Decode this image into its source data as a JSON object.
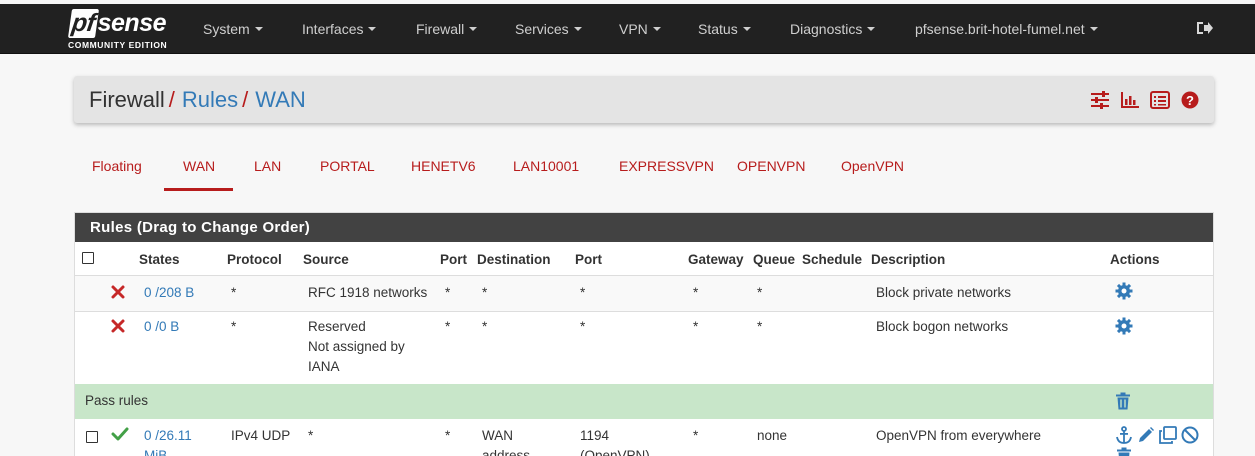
{
  "brand": {
    "logo_pf": "pf",
    "logo_sense": "sense",
    "edition": "COMMUNITY EDITION"
  },
  "nav": {
    "items": [
      {
        "label": "System"
      },
      {
        "label": "Interfaces"
      },
      {
        "label": "Firewall"
      },
      {
        "label": "Services"
      },
      {
        "label": "VPN"
      },
      {
        "label": "Status"
      },
      {
        "label": "Diagnostics"
      },
      {
        "label": "pfsense.brit-hotel-fumel.net"
      }
    ],
    "logout_icon": "logout-icon"
  },
  "breadcrumb": {
    "first": "Firewall",
    "second": "Rules",
    "third": "WAN",
    "separator": "/"
  },
  "breadcrumb_icons": [
    "sliders-icon",
    "bar-chart-icon",
    "list-icon",
    "help-icon"
  ],
  "tabs": [
    {
      "label": "Floating"
    },
    {
      "label": "WAN"
    },
    {
      "label": "LAN"
    },
    {
      "label": "PORTAL"
    },
    {
      "label": "HENETV6"
    },
    {
      "label": "LAN10001"
    },
    {
      "label": "EXPRESSVPN"
    },
    {
      "label": "OPENVPN"
    },
    {
      "label": "OpenVPN"
    }
  ],
  "active_tab": "WAN",
  "colors": {
    "accent": "#b71c1c",
    "link": "#337ab7",
    "navbar": "#212121",
    "pass_row": "#c8e6c9",
    "pass_icon": "#43a047"
  },
  "rules": {
    "title": "Rules (Drag to Change Order)",
    "columns": {
      "states": "States",
      "protocol": "Protocol",
      "source": "Source",
      "port": "Port",
      "destination": "Destination",
      "dest_port": "Port",
      "gateway": "Gateway",
      "queue": "Queue",
      "schedule": "Schedule",
      "description": "Description",
      "actions": "Actions"
    },
    "rows": [
      {
        "status": "block",
        "states": "0 /208 B",
        "protocol": "*",
        "source": "RFC 1918 networks",
        "port": "*",
        "destination": "*",
        "dest_port": "*",
        "gateway": "*",
        "queue": "*",
        "description": "Block private networks"
      },
      {
        "status": "block",
        "states": "0 /0 B",
        "protocol": "*",
        "source_lines": [
          "Reserved",
          "Not assigned by",
          "IANA"
        ],
        "port": "*",
        "destination": "*",
        "dest_port": "*",
        "gateway": "*",
        "queue": "*",
        "description": "Block bogon networks"
      }
    ],
    "separator_label": "Pass rules",
    "pass_rows": [
      {
        "status": "pass",
        "states_lines": [
          "0 /26.11",
          "MiB"
        ],
        "protocol": "IPv4 UDP",
        "source": "*",
        "port": "*",
        "destination_lines": [
          "WAN",
          "address"
        ],
        "dest_port_lines": [
          "1194",
          "(OpenVPN)"
        ],
        "gateway": "*",
        "queue": "none",
        "description": "OpenVPN from everywhere"
      }
    ]
  }
}
